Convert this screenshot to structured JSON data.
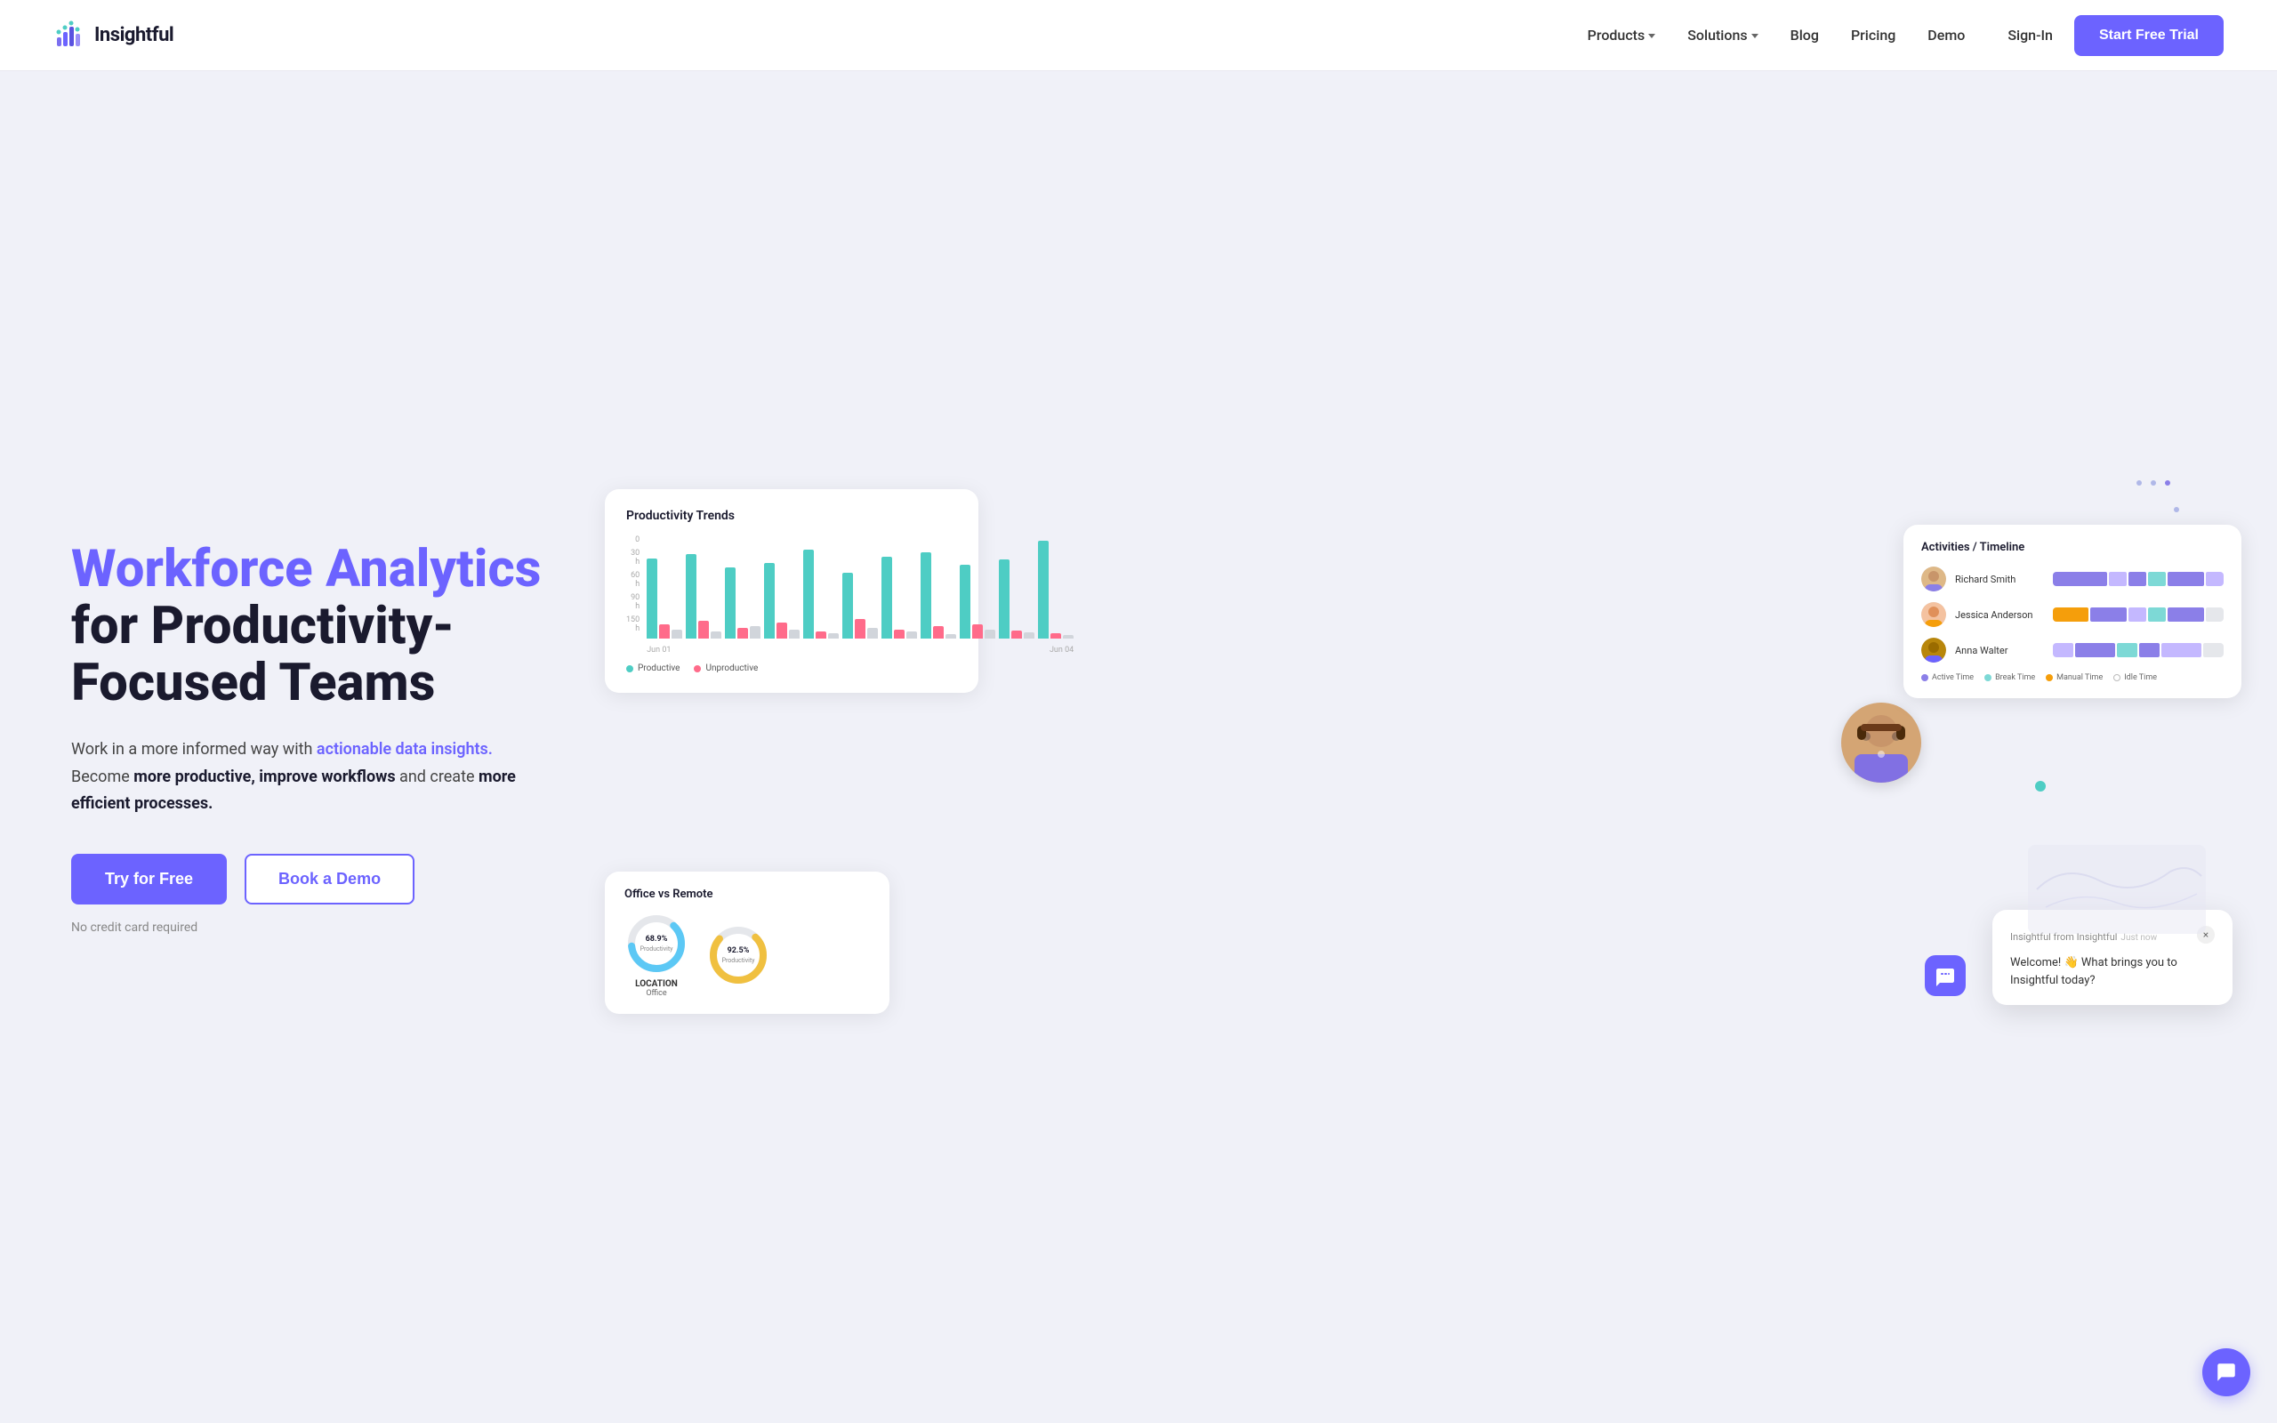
{
  "brand": {
    "name": "Insightful",
    "logo_bars": [
      18,
      24,
      32,
      20,
      14
    ]
  },
  "nav": {
    "links": [
      {
        "id": "products",
        "label": "Products",
        "has_dropdown": true
      },
      {
        "id": "solutions",
        "label": "Solutions",
        "has_dropdown": true
      },
      {
        "id": "blog",
        "label": "Blog",
        "has_dropdown": false
      },
      {
        "id": "pricing",
        "label": "Pricing",
        "has_dropdown": false
      },
      {
        "id": "demo",
        "label": "Demo",
        "has_dropdown": false
      }
    ],
    "signin_label": "Sign-In",
    "cta_label": "Start Free Trial"
  },
  "hero": {
    "title_purple": "Workforce Analytics",
    "title_dark1": "for Productivity-",
    "title_dark2": "Focused Teams",
    "desc_normal1": "Work in a more informed way with ",
    "desc_link": "actionable data insights.",
    "desc_normal2": " Become ",
    "desc_bold1": "more productive, improve workflows",
    "desc_normal3": " and create ",
    "desc_bold2": "more efficient processes.",
    "try_label": "Try for Free",
    "demo_label": "Book a Demo",
    "no_credit": "No credit card required"
  },
  "productivity_card": {
    "title": "Productivity Trends",
    "y_labels": [
      "150 h",
      "90 h",
      "60 h",
      "30 h",
      "0"
    ],
    "x_labels": [
      "Jun 01",
      "Jun 04"
    ],
    "legend": [
      {
        "color": "teal",
        "label": "Productive"
      },
      {
        "color": "pink",
        "label": "Unproductive"
      }
    ],
    "bars": [
      {
        "teal": 85,
        "pink": 15,
        "gray": 10
      },
      {
        "teal": 90,
        "pink": 20,
        "gray": 8
      },
      {
        "teal": 75,
        "pink": 12,
        "gray": 15
      },
      {
        "teal": 80,
        "pink": 18,
        "gray": 10
      },
      {
        "teal": 95,
        "pink": 8,
        "gray": 6
      },
      {
        "teal": 70,
        "pink": 22,
        "gray": 12
      },
      {
        "teal": 88,
        "pink": 10,
        "gray": 8
      },
      {
        "teal": 92,
        "pink": 14,
        "gray": 5
      },
      {
        "teal": 78,
        "pink": 16,
        "gray": 10
      },
      {
        "teal": 85,
        "pink": 9,
        "gray": 7
      },
      {
        "teal": 96,
        "pink": 6,
        "gray": 4
      }
    ]
  },
  "timeline_card": {
    "title": "Activities / Timeline",
    "users": [
      {
        "name": "Richard Smith"
      },
      {
        "name": "Jessica Anderson"
      },
      {
        "name": "Anna Walter"
      }
    ],
    "legend": [
      {
        "color": "purple",
        "label": "Active Time"
      },
      {
        "color": "teal",
        "label": "Break Time"
      },
      {
        "color": "orange",
        "label": "Manual Time"
      },
      {
        "color": "gray",
        "label": "Idle Time"
      }
    ]
  },
  "office_card": {
    "title": "Office vs Remote",
    "office": {
      "percent": 68.9,
      "label": "Productivity",
      "location": "LOCATION",
      "location_name": "Office"
    },
    "remote": {
      "percent": 92.5,
      "label": "Productivity"
    }
  },
  "chat_widget": {
    "from_label": "Insightful from Insightful",
    "time": "Just now",
    "message": "Welcome! 👋 What brings you to Insightful today?",
    "close_label": "×"
  }
}
